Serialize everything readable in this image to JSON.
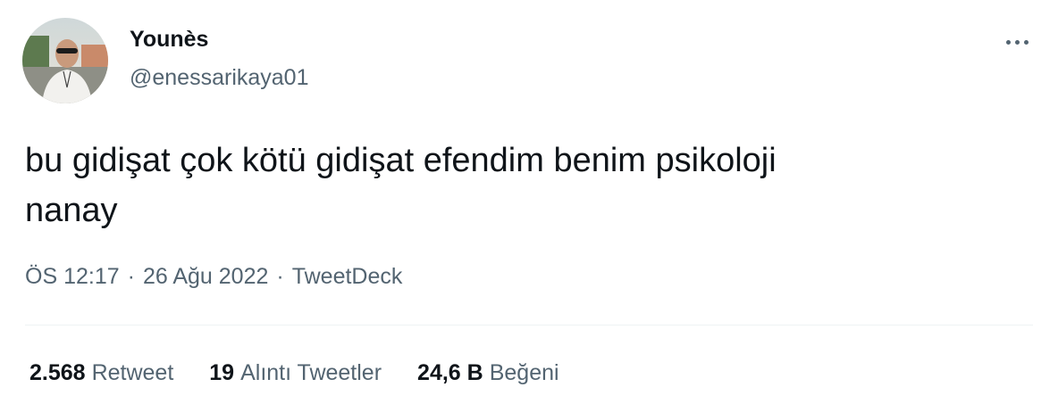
{
  "author": {
    "name": "Younès",
    "handle": "@enessarikaya01"
  },
  "tweet": {
    "text": "bu gidişat çok kötü gidişat efendim benim psikoloji\nnanay"
  },
  "meta": {
    "time": "ÖS 12:17",
    "date": "26 Ağu 2022",
    "source": "TweetDeck",
    "separator": "·"
  },
  "stats": {
    "retweets_count": "2.568",
    "retweets_label": "Retweet",
    "quotes_count": "19",
    "quotes_label": "Alıntı Tweetler",
    "likes_count": "24,6 B",
    "likes_label": "Beğeni"
  },
  "colors": {
    "text": "#0f1419",
    "secondary": "#536471",
    "divider": "#eff3f4"
  },
  "icons": {
    "more": "more-dots-icon"
  }
}
